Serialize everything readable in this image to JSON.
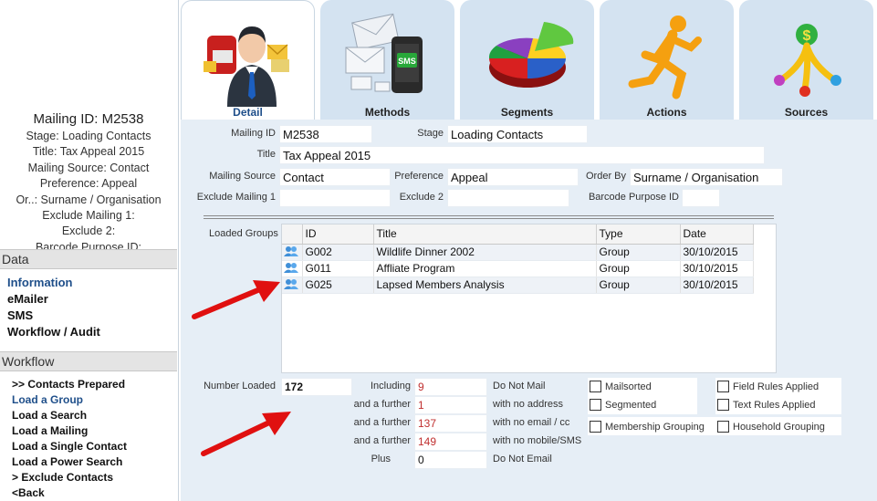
{
  "summary": {
    "title": "Mailing ID: M2538",
    "lines": [
      "Stage: Loading Contacts",
      "Title: Tax Appeal 2015",
      "Mailing Source: Contact",
      "Preference: Appeal",
      "Or..: Surname / Organisation",
      "Exclude Mailing 1:",
      "Exclude 2:",
      "Barcode Purpose ID:"
    ]
  },
  "sidebar": {
    "data_header": "Data",
    "data_links": [
      "Information",
      "eMailer",
      "SMS",
      "Workflow / Audit"
    ],
    "workflow_header": "Workflow",
    "workflow_links": [
      ">> Contacts Prepared",
      "Load a Group",
      "Load a Search",
      "Load a Mailing",
      "Load a Single Contact",
      "Load a Power Search",
      "> Exclude Contacts",
      "<Back"
    ]
  },
  "tabs": [
    {
      "label": "Detail",
      "icon": "businessman-mail-icon"
    },
    {
      "label": "Methods",
      "icon": "email-sms-icon"
    },
    {
      "label": "Segments",
      "icon": "pie-chart-icon"
    },
    {
      "label": "Actions",
      "icon": "running-man-icon"
    },
    {
      "label": "Sources",
      "icon": "dollar-fountain-icon"
    }
  ],
  "form": {
    "mailing_id_label": "Mailing ID",
    "mailing_id": "M2538",
    "stage_label": "Stage",
    "stage": "Loading Contacts",
    "title_label": "Title",
    "title": "Tax Appeal 2015",
    "mailing_source_label": "Mailing Source",
    "mailing_source": "Contact",
    "preference_label": "Preference",
    "preference": "Appeal",
    "order_by_label": "Order By",
    "order_by": "Surname / Organisation",
    "exclude_mailing_1_label": "Exclude Mailing 1",
    "exclude_mailing_1": "",
    "exclude_2_label": "Exclude 2",
    "exclude_2": "",
    "barcode_purpose_label": "Barcode Purpose ID",
    "barcode_purpose": ""
  },
  "groups": {
    "label": "Loaded Groups",
    "columns": [
      "ID",
      "Title",
      "Type",
      "Date"
    ],
    "rows": [
      {
        "id": "G002",
        "title": "Wildlife Dinner 2002",
        "type": "Group",
        "date": "30/10/2015"
      },
      {
        "id": "G011",
        "title": "Affliate Program",
        "type": "Group",
        "date": "30/10/2015"
      },
      {
        "id": "G025",
        "title": "Lapsed Members Analysis",
        "type": "Group",
        "date": "30/10/2015"
      }
    ]
  },
  "counts": {
    "number_loaded_label": "Number Loaded",
    "number_loaded": "172",
    "rows": [
      {
        "prefix": "Including",
        "value": "9",
        "suffix": "Do Not Mail"
      },
      {
        "prefix": "and a further",
        "value": "1",
        "suffix": "with no address"
      },
      {
        "prefix": "and a further",
        "value": "137",
        "suffix": "with no email / cc"
      },
      {
        "prefix": "and a further",
        "value": "149",
        "suffix": "with no mobile/SMS"
      },
      {
        "prefix": "Plus",
        "value": "0",
        "suffix": "Do Not Email"
      }
    ]
  },
  "checkboxes": {
    "mailsorted": "Mailsorted",
    "segmented": "Segmented",
    "membership_grouping": "Membership Grouping",
    "field_rules_applied": "Field Rules Applied",
    "text_rules_applied": "Text Rules Applied",
    "household_grouping": "Household Grouping"
  },
  "colors": {
    "accent": "#1f4f8a",
    "tab_bg": "#d4e3f1",
    "panel_bg": "#e6eef6",
    "arrow": "#e01010",
    "count_red": "#c03030"
  }
}
